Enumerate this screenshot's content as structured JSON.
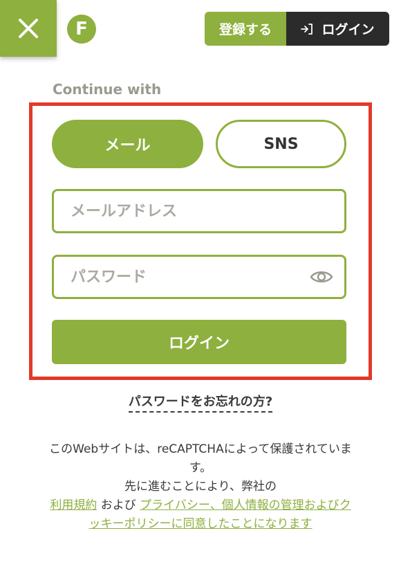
{
  "header": {
    "logo_letter": "F",
    "register_label": "登録する",
    "login_label": "ログイン"
  },
  "auth": {
    "continue_with": "Continue with",
    "tabs": [
      {
        "label": "メール",
        "active": true
      },
      {
        "label": "SNS",
        "active": false
      }
    ],
    "email_placeholder": "メールアドレス",
    "password_placeholder": "パスワード",
    "submit_label": "ログイン",
    "forgot_label": "パスワードをお忘れの方?"
  },
  "notice": {
    "line1": "このWebサイトは、reCAPTCHAによって保護されています。",
    "line2": "先に進むことにより、弊社の",
    "terms_link": "利用規約",
    "and": " および ",
    "privacy_link": "プライバシー、個人情報の管理およびクッキーポリシーに同意したことになります"
  },
  "colors": {
    "brand_green": "#8db03e",
    "highlight_red": "#e13a2a",
    "dark_button": "#2b2b2b"
  }
}
